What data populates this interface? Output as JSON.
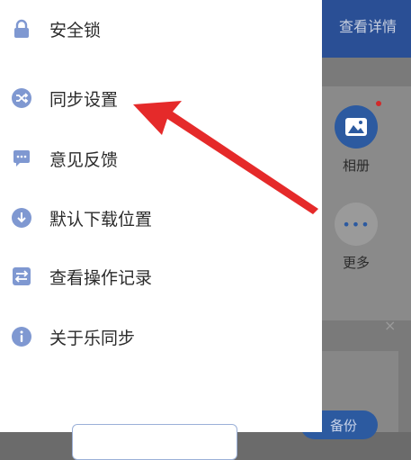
{
  "background": {
    "header_link": "查看详情",
    "tiles": {
      "album_label": "相册",
      "more_label": "更多",
      "more_glyph": "•••"
    },
    "close_glyph": "×",
    "pill_label": "备份"
  },
  "drawer": {
    "items": [
      {
        "label": "安全锁",
        "icon": "lock-icon"
      },
      {
        "label": "同步设置",
        "icon": "shuffle-icon"
      },
      {
        "label": "意见反馈",
        "icon": "feedback-icon"
      },
      {
        "label": "默认下载位置",
        "icon": "download-icon"
      },
      {
        "label": "查看操作记录",
        "icon": "swap-icon"
      },
      {
        "label": "关于乐同步",
        "icon": "info-icon"
      }
    ]
  },
  "colors": {
    "icon": "#7f98d1",
    "header_bg": "#2a4f95",
    "annotation": "#e52a2a"
  }
}
